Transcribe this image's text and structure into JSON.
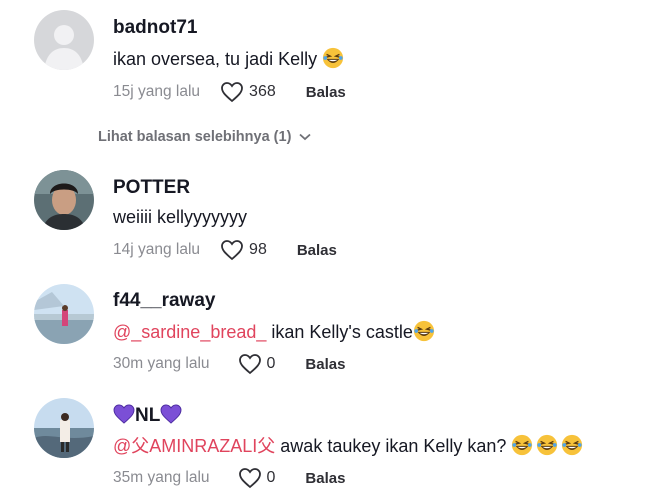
{
  "comments": [
    {
      "username": "badnot71",
      "text": "ikan oversea, tu jadi Kelly",
      "time": "15j yang lalu",
      "likes": "368",
      "reply_label": "Balas",
      "avatar": "default-avatar"
    },
    {
      "username": "POTTER",
      "text": "weiiii kellyyyyyyy",
      "time": "14j yang lalu",
      "likes": "98",
      "reply_label": "Balas",
      "avatar": "photo-avatar"
    },
    {
      "username": "f44__raway",
      "mention": "@_sardine_bread_",
      "text": " ikan Kelly's castle",
      "time": "30m yang lalu",
      "likes": "0",
      "reply_label": "Balas",
      "avatar": "photo-avatar"
    },
    {
      "username": "NL",
      "mention": "@父AMINRAZALI父",
      "text": " awak taukey ikan Kelly kan? ",
      "time": "35m yang lalu",
      "likes": "0",
      "reply_label": "Balas",
      "avatar": "photo-avatar"
    }
  ],
  "view_more_replies": "Lihat balasan selebihnya (1)",
  "icons": {
    "like": "heart-outline-icon",
    "expand": "chevron-down-icon",
    "emoji": "grinning-squinting-face-emoji",
    "name_decoration": "purple-heart-emoji"
  },
  "colors": {
    "mention": "#e0445d",
    "secondary_text": "#8a8b91",
    "primary_text": "#161823",
    "emoji_face": "#f7c23a",
    "purple_heart": "#7b4fd6"
  }
}
